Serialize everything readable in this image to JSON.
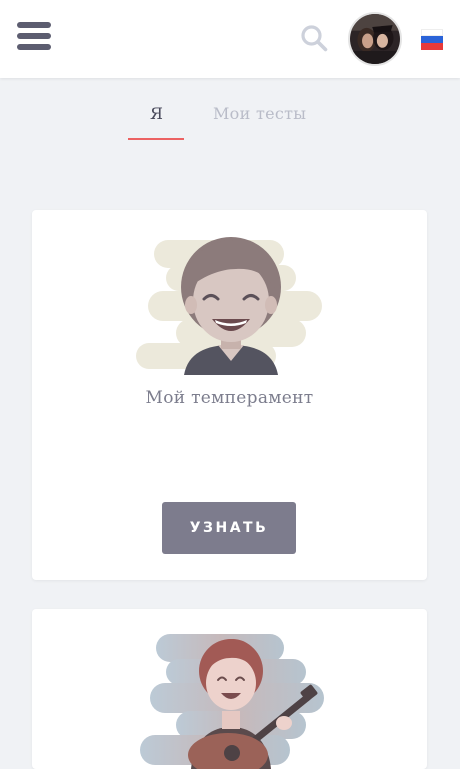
{
  "header": {
    "menu_icon": "hamburger-menu-icon",
    "search_icon": "search-icon",
    "avatar": "user-avatar",
    "language_flag": "russian-flag-icon"
  },
  "tabs": [
    {
      "label": "Я",
      "active": true
    },
    {
      "label": "Мои тесты",
      "active": false
    }
  ],
  "cards": [
    {
      "title": "Мой темперамент",
      "button_label": "УЗНАТЬ",
      "illustration": "smiling-person-illustration"
    },
    {
      "title": "",
      "button_label": "",
      "illustration": "guitar-player-illustration"
    }
  ],
  "colors": {
    "accent": "#ec6262",
    "button": "#7d7c8d",
    "background": "#f0f2f5",
    "menu_icon": "#5c5d70",
    "flag": [
      "#ffffff",
      "#2a63d8",
      "#e73a3a"
    ]
  }
}
